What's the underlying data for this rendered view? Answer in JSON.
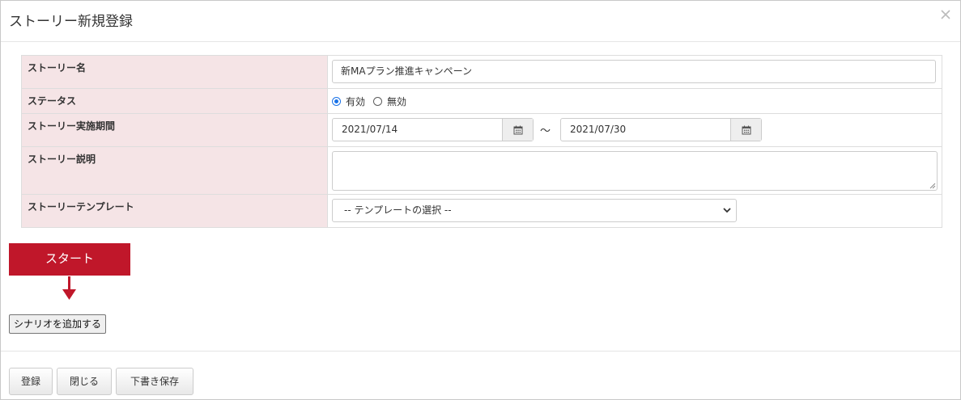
{
  "modal": {
    "title": "ストーリー新規登録",
    "close_icon": "close-icon"
  },
  "form": {
    "name": {
      "label": "ストーリー名",
      "value": "新MAプラン推進キャンペーン"
    },
    "status": {
      "label": "ステータス",
      "options": [
        {
          "label": "有効",
          "checked": true
        },
        {
          "label": "無効",
          "checked": false
        }
      ]
    },
    "period": {
      "label": "ストーリー実施期間",
      "start": "2021/07/14",
      "separator": "〜",
      "end": "2021/07/30",
      "icon": "calendar-icon"
    },
    "description": {
      "label": "ストーリー説明",
      "value": ""
    },
    "template": {
      "label": "ストーリーテンプレート",
      "selected": "-- テンプレートの選択 --"
    }
  },
  "flow": {
    "start_label": "スタート",
    "add_scenario_label": "シナリオを追加する"
  },
  "footer": {
    "register_label": "登録",
    "close_label": "閉じる",
    "draft_label": "下書き保存"
  },
  "colors": {
    "label_bg": "#f5e4e6",
    "start_bg": "#c0172a",
    "radio_accent": "#1a73e8"
  }
}
